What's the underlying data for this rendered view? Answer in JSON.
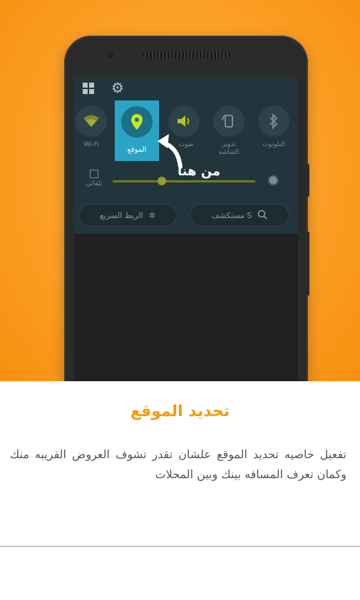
{
  "quick_settings": {
    "tiles": [
      {
        "label": "Wi-Fi",
        "icon": "wifi-icon"
      },
      {
        "label": "الموقع",
        "icon": "location-pin-icon"
      },
      {
        "label": "صوت",
        "icon": "volume-icon"
      },
      {
        "label": "تدوير الشاشة",
        "icon": "rotate-screen-icon"
      },
      {
        "label": "البلوتوث",
        "icon": "bluetooth-icon"
      }
    ],
    "auto_brightness_label": "تلقائي",
    "brightness_level": 0.35,
    "quick_connect_label": "الربط السريع",
    "finder_label": "مستكشف S",
    "accent_color": "#2aa4c6",
    "active_icon_color": "#c6e61e"
  },
  "callout": {
    "text": "من هنا"
  },
  "content": {
    "title": "تحديد الموقع",
    "description": "تفعيل خاصيه تحديد الموقع علشان تقدر تشوف العروض القريبه منك وكمان تعرف المسافه بينك وبين المحلات"
  },
  "colors": {
    "background_orange": "#fca22a",
    "title_orange": "#f39c12"
  }
}
